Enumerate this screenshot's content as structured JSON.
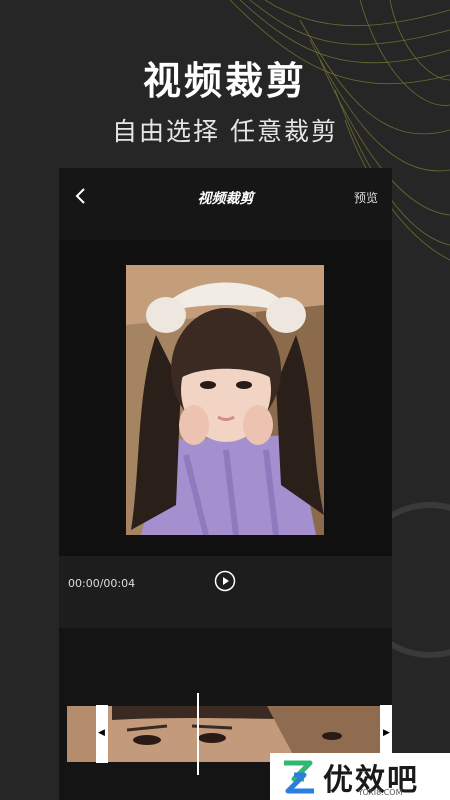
{
  "promo": {
    "headline": "视频裁剪",
    "subline": "自由选择 任意裁剪"
  },
  "app": {
    "nav": {
      "back_icon": "chevron-left-icon",
      "title": "视频裁剪",
      "preview_label": "预览"
    },
    "player": {
      "time": "00:00/00:04",
      "play_icon": "play-circle-icon"
    },
    "timeline": {
      "left_handle_icon": "triangle-left-icon",
      "right_handle_icon": "triangle-right-icon"
    }
  },
  "watermark": {
    "text": "优效吧",
    "url": "YOXI8.COM"
  },
  "colors": {
    "background": "#262626",
    "deco_lines": "#8c8a35",
    "logo_green": "#2fb870",
    "logo_blue": "#2a7de1"
  }
}
